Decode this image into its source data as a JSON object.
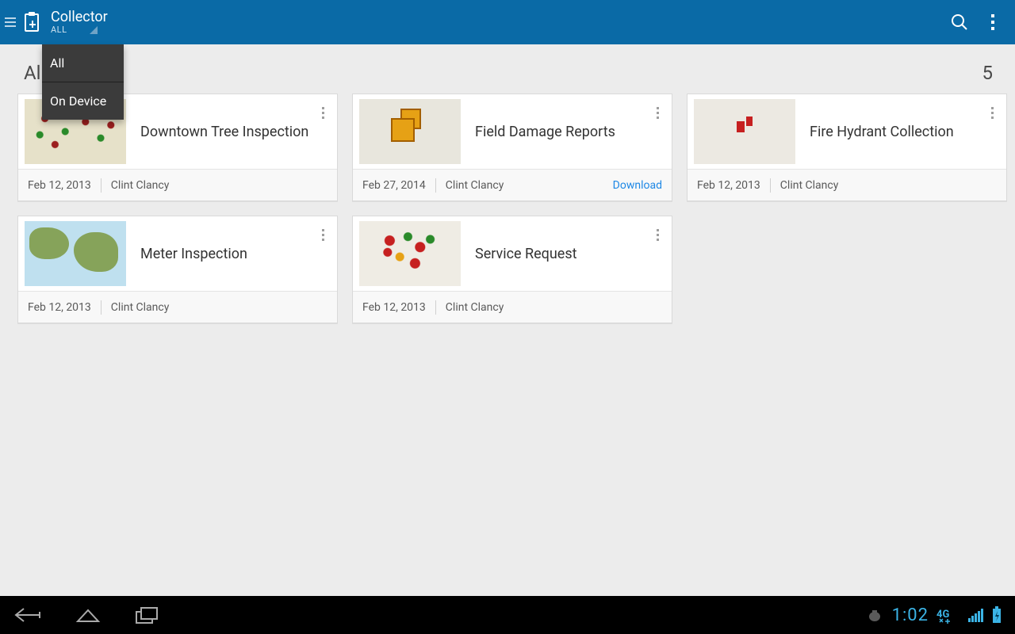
{
  "actionbar": {
    "title": "Collector",
    "subtitle": "ALL"
  },
  "dropdown": {
    "items": [
      "All",
      "On Device"
    ]
  },
  "section": {
    "title": "All",
    "count": "5"
  },
  "cards": [
    {
      "title": "Downtown Tree Inspection",
      "date": "Feb 12, 2013",
      "author": "Clint Clancy",
      "thumb": "trees",
      "download": null
    },
    {
      "title": "Field Damage Reports",
      "date": "Feb 27, 2014",
      "author": "Clint Clancy",
      "thumb": "damage",
      "download": "Download"
    },
    {
      "title": "Fire Hydrant Collection",
      "date": "Feb 12, 2013",
      "author": "Clint Clancy",
      "thumb": "hydrant",
      "download": null
    },
    {
      "title": "Meter Inspection",
      "date": "Feb 12, 2013",
      "author": "Clint Clancy",
      "thumb": "world",
      "download": null
    },
    {
      "title": "Service Request",
      "date": "Feb 12, 2013",
      "author": "Clint Clancy",
      "thumb": "service",
      "download": null
    }
  ],
  "status": {
    "time": "1:02",
    "network": "4G",
    "battery_charging": true
  }
}
